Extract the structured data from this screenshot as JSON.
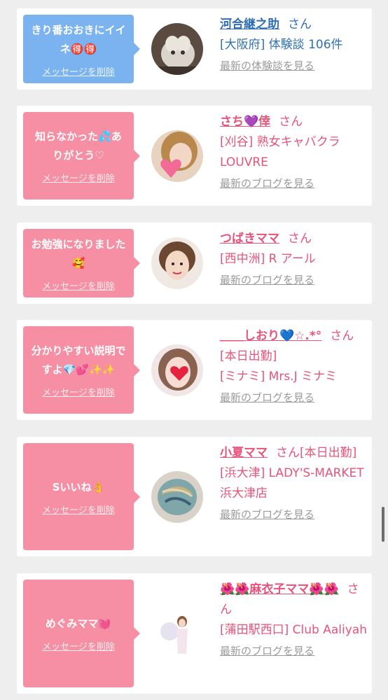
{
  "cards": [
    {
      "message": "きり番おおきにイイネ🉐🉐",
      "delete_label": "メッセージを削除",
      "name": "河合継之助",
      "honorific": "さん",
      "detail": "[大阪府] 体験談 106件",
      "link": "最新の体験談を見る",
      "theme": "blue"
    },
    {
      "message": "知らなかった💦ありがとう♡",
      "delete_label": "メッセージを削除",
      "name": "さち💜倖",
      "honorific": "さん",
      "detail": "[刈谷] 熟女キャバクラLOUVRE",
      "link": "最新のブログを見る",
      "theme": "pink"
    },
    {
      "message": "お勉強になりました🥰",
      "delete_label": "メッセージを削除",
      "name": "つばきママ",
      "honorific": "さん",
      "detail": "[西中洲] R アール",
      "link": "最新のブログを見る",
      "theme": "pink"
    },
    {
      "message": "分かりやすい説明ですよ💎💕✨✨",
      "delete_label": "メッセージを削除",
      "name": "＿＿しおり💙☆.*°",
      "honorific": "さん[本日出勤]",
      "detail": "[ミナミ] Mrs.J ミナミ",
      "link": "最新のブログを見る",
      "theme": "pink"
    },
    {
      "message": "Sいいね👌",
      "delete_label": "メッセージを削除",
      "name": "小夏ママ",
      "honorific": "さん[本日出勤]",
      "detail": "[浜大津] LADY'S-MARKET 浜大津店",
      "link": "最新のブログを見る",
      "theme": "pink"
    },
    {
      "message": "めぐみママ💓",
      "delete_label": "メッセージを削除",
      "name": "🌺🌺麻衣子ママ🌺🌺",
      "honorific": "さん",
      "detail": "[蒲田駅西口] Club Aaliyah",
      "link": "最新のブログを見る",
      "theme": "pink"
    }
  ],
  "colors": {
    "pink_bubble": "#f78fa4",
    "blue_bubble": "#7ab3ef",
    "pink_text": "#e8537a",
    "blue_text": "#2f6fb7",
    "link_gray": "#9a9a9a"
  }
}
